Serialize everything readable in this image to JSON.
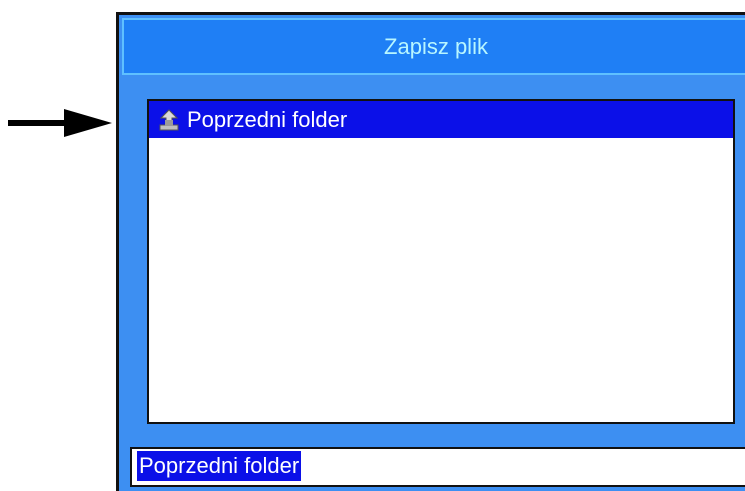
{
  "dialog": {
    "title": "Zapisz plik",
    "list": {
      "items": [
        {
          "label": "Poprzedni folder",
          "icon": "folder-up-icon",
          "selected": true
        }
      ]
    },
    "filename_field": {
      "value": "Poprzedni folder",
      "selected": true
    }
  },
  "colors": {
    "dialog_bg": "#3d8ff2",
    "title_bar_bg": "#1f7ff5",
    "title_text": "#b8f6ff",
    "selection": "#0b10e8",
    "arrow": "#000000"
  }
}
